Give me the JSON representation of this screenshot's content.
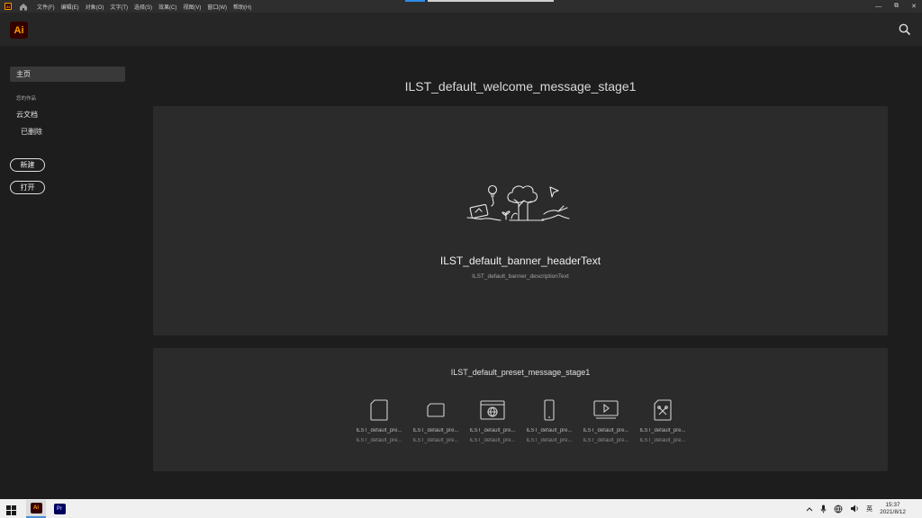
{
  "menu": {
    "app_icon": "Ai",
    "items": [
      "文件(F)",
      "编辑(E)",
      "对象(O)",
      "文字(T)",
      "选择(S)",
      "效果(C)",
      "视图(V)",
      "窗口(W)",
      "帮助(H)"
    ],
    "window_controls": [
      "—",
      "⧉",
      "✕"
    ]
  },
  "header": {
    "logo": "Ai",
    "search_icon": "search-icon"
  },
  "sidebar": {
    "home": "主页",
    "section_heading": "您的作品",
    "cloud_docs": "云文档",
    "deleted": "已删除",
    "new_button": "新建",
    "open_button": "打开"
  },
  "main": {
    "welcome": "ILST_default_welcome_message_stage1",
    "banner_title": "ILST_default_banner_headerText",
    "banner_desc": "ILST_default_banner_descriptionText",
    "preset_title": "ILST_default_preset_message_stage1",
    "presets": [
      {
        "name": "ILST_default_pre...",
        "size": "ILST_default_pre...",
        "icon": "document-icon"
      },
      {
        "name": "ILST_default_pre...",
        "size": "ILST_default_pre...",
        "icon": "card-icon"
      },
      {
        "name": "ILST_default_pre...",
        "size": "ILST_default_pre...",
        "icon": "web-icon"
      },
      {
        "name": "ILST_default_pre...",
        "size": "ILST_default_pre...",
        "icon": "mobile-icon"
      },
      {
        "name": "ILST_default_pre...",
        "size": "ILST_default_pre...",
        "icon": "video-icon"
      },
      {
        "name": "ILST_default_pre...",
        "size": "ILST_default_pre...",
        "icon": "art-icon"
      }
    ]
  },
  "taskbar": {
    "ai_label": "Ai",
    "pr_label": "Pr",
    "ime": "英",
    "time": "15:37",
    "date": "2021/8/12"
  },
  "colors": {
    "accent": "#ff9a00",
    "background": "#1d1d1d",
    "panel": "#2b2b2b"
  }
}
